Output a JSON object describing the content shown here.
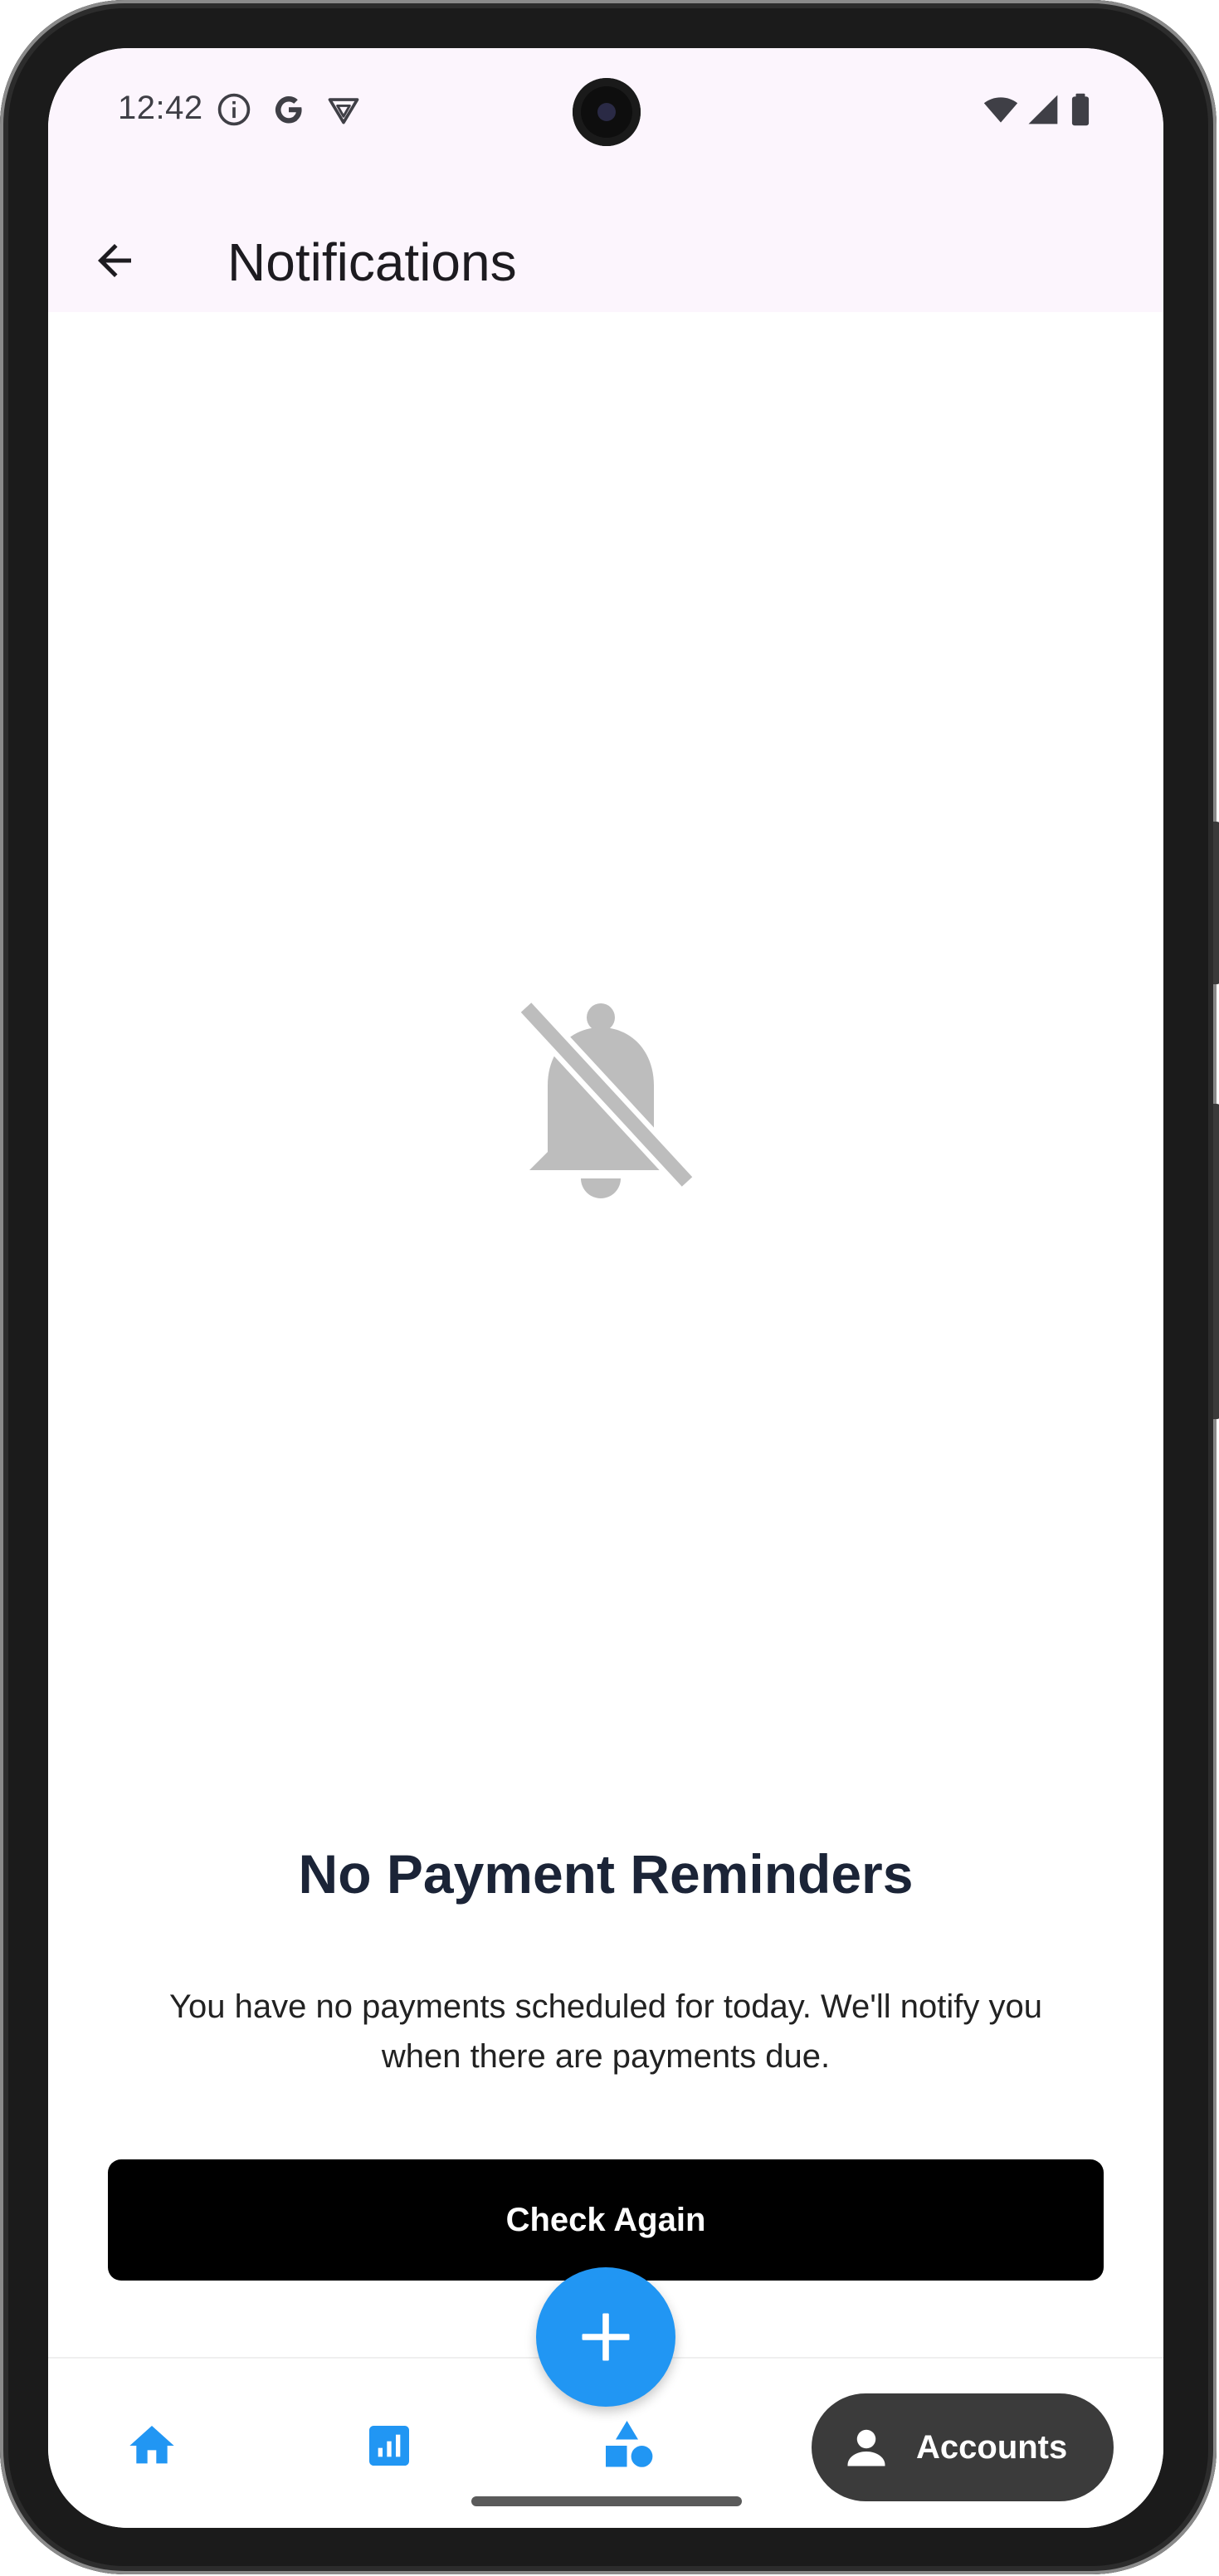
{
  "status_bar": {
    "time": "12:42",
    "left_icons": [
      "info-icon",
      "google-icon",
      "vpn-shield-icon"
    ],
    "right_icons": [
      "wifi-icon",
      "signal-icon",
      "battery-icon"
    ]
  },
  "app_bar": {
    "back_icon": "arrow-back-icon",
    "title": "Notifications"
  },
  "empty_state": {
    "icon": "notifications-off-icon",
    "icon_color": "#bdbdbd",
    "title": "No Payment Reminders",
    "message": "You have no payments scheduled for today. We'll notify you when there are payments due.",
    "button_label": "Check Again"
  },
  "bottom_nav": {
    "items": [
      {
        "icon": "home-icon",
        "label": ""
      },
      {
        "icon": "chart-icon",
        "label": ""
      },
      {
        "icon": "categories-icon",
        "label": ""
      },
      {
        "icon": "person-icon",
        "label": "Accounts",
        "selected": true
      }
    ],
    "fab_icon": "plus-icon"
  },
  "colors": {
    "accent": "#2196f3",
    "top_tint": "#fcf5fd",
    "title_text": "#1b2437",
    "selected_pill": "#3b3b3b"
  }
}
